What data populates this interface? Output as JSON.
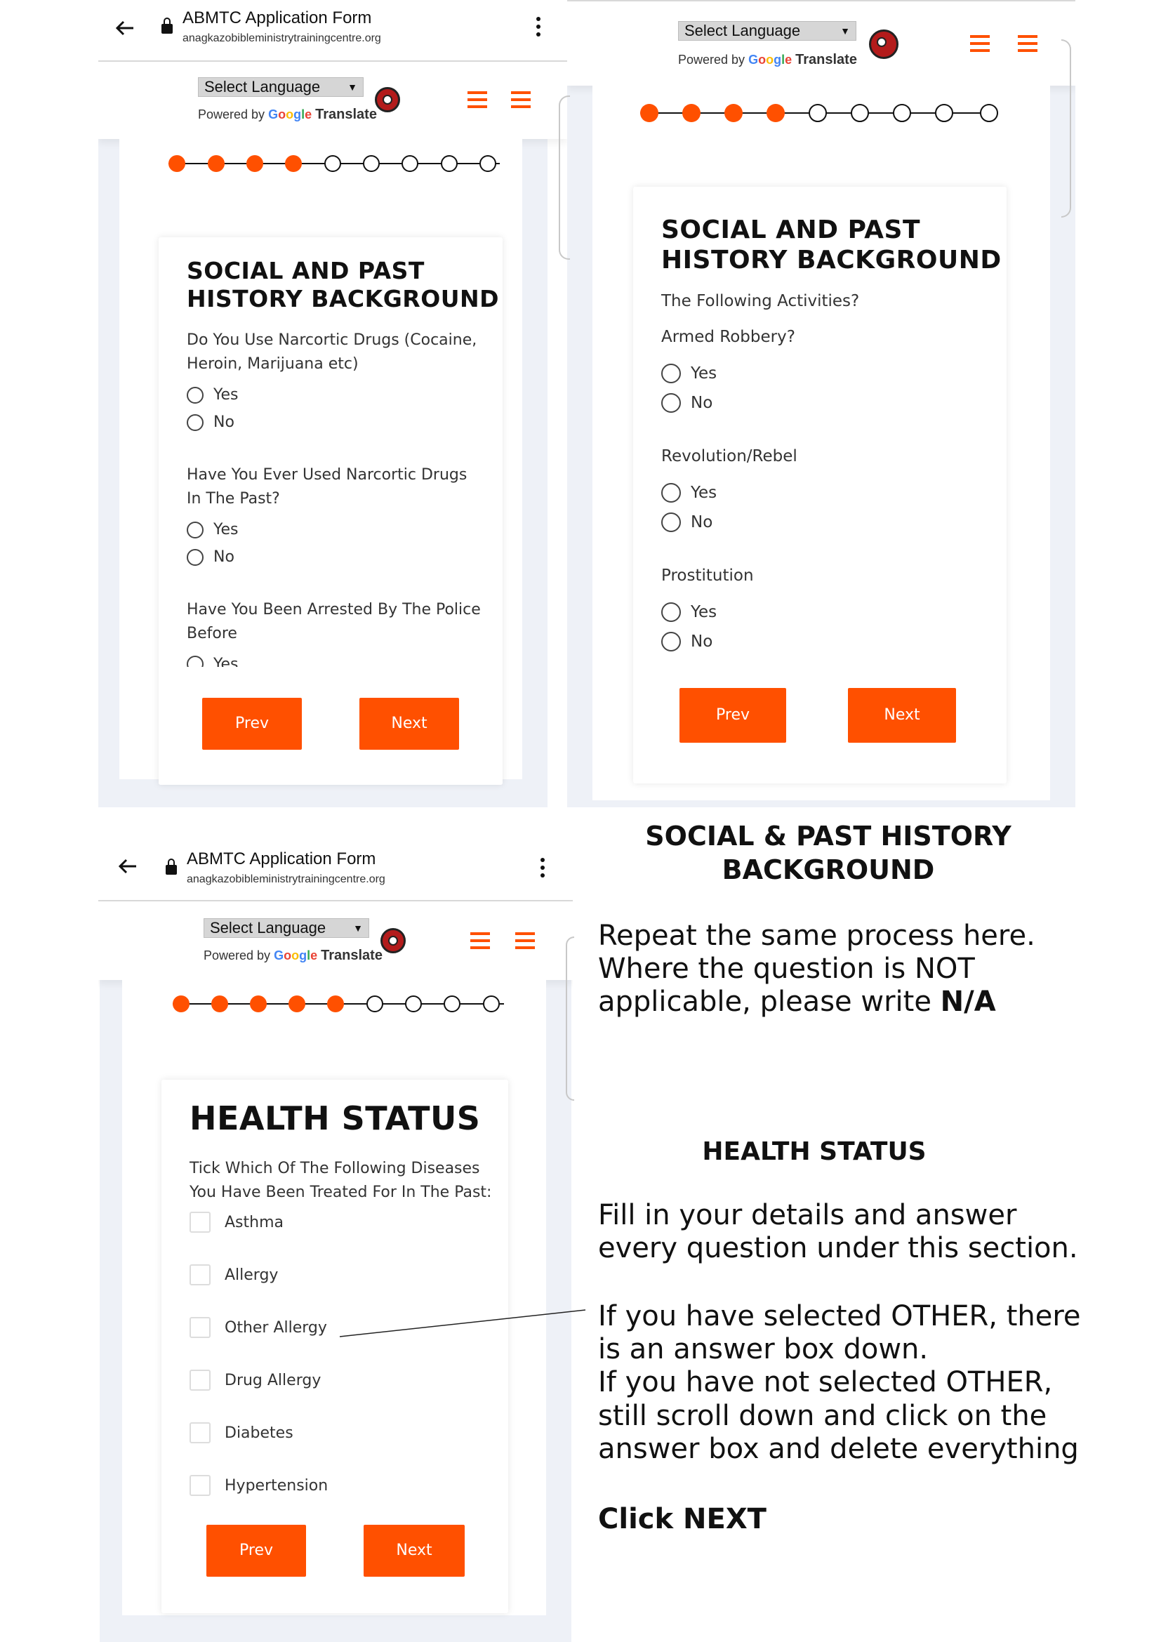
{
  "browser": {
    "title": "ABMTC Application Form",
    "host": "anagkazobibleministrytrainingcentre.org"
  },
  "translate": {
    "select_label": "Select Language",
    "powered_by": "Powered by",
    "google": [
      "G",
      "o",
      "o",
      "g",
      "l",
      "e"
    ],
    "translate_word": "Translate"
  },
  "panel1": {
    "title_line1": "SOCIAL AND PAST",
    "title_line2": "HISTORY BACKGROUND",
    "q1": "Do You Use Narcortic Drugs (Cocaine, Heroin, Marijuana etc)",
    "q2": "Have You Ever Used Narcortic Drugs In The Past?",
    "q3": "Have You Been Arrested By The Police Before",
    "yes": "Yes",
    "no": "No",
    "prev": "Prev",
    "next": "Next",
    "progress": {
      "filled": 4,
      "total": 9
    }
  },
  "panel2": {
    "title_line1": "SOCIAL AND PAST",
    "title_line2": "HISTORY BACKGROUND",
    "subtitle": "The Following Activities?",
    "q1": "Armed Robbery?",
    "q2": "Revolution/Rebel",
    "q3": "Prostitution",
    "yes": "Yes",
    "no": "No",
    "prev": "Prev",
    "next": "Next",
    "progress": {
      "filled": 4,
      "total": 9
    }
  },
  "panel3": {
    "title": "HEALTH STATUS",
    "question": "Tick Which Of The Following Diseases You Have Been Treated For In The Past:",
    "options": [
      "Asthma",
      "Allergy",
      "Other Allergy",
      "Drug Allergy",
      "Diabetes",
      "Hypertension"
    ],
    "prev": "Prev",
    "next": "Next",
    "progress": {
      "filled": 5,
      "total": 9
    }
  },
  "instructions": {
    "social_heading_line1": "SOCIAL & PAST HISTORY",
    "social_heading_line2": "BACKGROUND",
    "social_text_line1": "Repeat the same process here.",
    "social_text_line2": "Where the question is NOT",
    "social_text_line3": "applicable, please write",
    "social_text_na": "N/A",
    "health_heading": "HEALTH STATUS",
    "health_text_line1": "Fill in your details and answer",
    "health_text_line2": "every question under this section.",
    "other_line1": "If you have selected OTHER, there",
    "other_line2": "is an answer box down.",
    "other_line3": "If you have not selected OTHER,",
    "other_line4": "still scroll down and click on the",
    "other_line5": "answer box and delete everything",
    "click_next": "Click NEXT"
  },
  "colors": {
    "accent": "#ff5000",
    "shell": "#eef1f7"
  }
}
